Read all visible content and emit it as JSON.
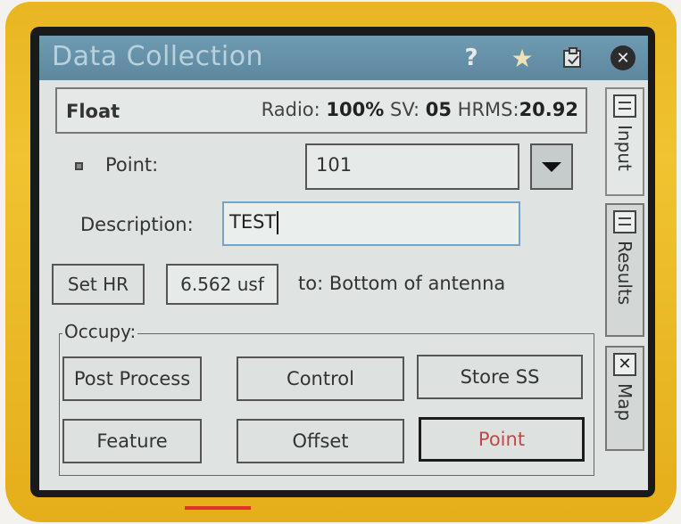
{
  "window": {
    "title": "Data Collection"
  },
  "status": {
    "solution": "Float",
    "radio_label": "Radio:",
    "radio_value": "100%",
    "sv_label": "SV:",
    "sv_value": "05",
    "hrms_label": "HRMS:",
    "hrms_value": "20.92"
  },
  "form": {
    "point_label": "Point:",
    "point_value": "101",
    "description_label": "Description:",
    "description_value": "TEST",
    "set_hr_label": "Set HR",
    "hr_value": "6.562 usf",
    "hr_to_label": "to: Bottom of antenna"
  },
  "occupy": {
    "group_label": "Occupy:",
    "buttons": [
      {
        "label": "Post Process"
      },
      {
        "label": "Control"
      },
      {
        "label": "Store SS"
      },
      {
        "label": "Feature"
      },
      {
        "label": "Offset"
      },
      {
        "label": "Point"
      }
    ]
  },
  "tabs": [
    {
      "label": "Input",
      "icon": "form-icon",
      "selected": true
    },
    {
      "label": "Results",
      "icon": "table-icon",
      "selected": false
    },
    {
      "label": "Map",
      "icon": "map-icon",
      "selected": false
    }
  ],
  "colors": {
    "device": "#e9b522",
    "titlebar": "#6f9bb2",
    "active_button_text": "#c44848",
    "focused_input_border": "#7aa3c3"
  }
}
